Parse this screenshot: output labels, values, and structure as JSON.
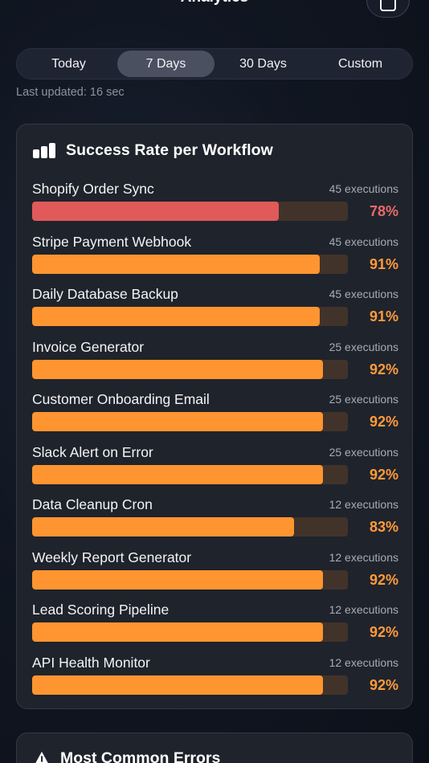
{
  "header": {
    "title": "Analytics",
    "action_icon": "share-icon"
  },
  "range_tabs": [
    {
      "label": "Today",
      "active": false
    },
    {
      "label": "7 Days",
      "active": true
    },
    {
      "label": "30 Days",
      "active": false
    },
    {
      "label": "Custom",
      "active": false
    }
  ],
  "last_updated": "Last updated: 16 sec",
  "success_card": {
    "title": "Success Rate per Workflow",
    "icon": "bar-chart-icon",
    "workflows": [
      {
        "name": "Shopify Order Sync",
        "executions": "45 executions",
        "rate": 0.78,
        "rate_label": "78%",
        "status": "critical"
      },
      {
        "name": "Stripe Payment Webhook",
        "executions": "45 executions",
        "rate": 0.91,
        "rate_label": "91%",
        "status": "warning"
      },
      {
        "name": "Daily Database Backup",
        "executions": "45 executions",
        "rate": 0.91,
        "rate_label": "91%",
        "status": "warning"
      },
      {
        "name": "Invoice Generator",
        "executions": "25 executions",
        "rate": 0.92,
        "rate_label": "92%",
        "status": "warning"
      },
      {
        "name": "Customer Onboarding Email",
        "executions": "25 executions",
        "rate": 0.92,
        "rate_label": "92%",
        "status": "warning"
      },
      {
        "name": "Slack Alert on Error",
        "executions": "25 executions",
        "rate": 0.92,
        "rate_label": "92%",
        "status": "warning"
      },
      {
        "name": "Data Cleanup Cron",
        "executions": "12 executions",
        "rate": 0.83,
        "rate_label": "83%",
        "status": "warning"
      },
      {
        "name": "Weekly Report Generator",
        "executions": "12 executions",
        "rate": 0.92,
        "rate_label": "92%",
        "status": "warning"
      },
      {
        "name": "Lead Scoring Pipeline",
        "executions": "12 executions",
        "rate": 0.92,
        "rate_label": "92%",
        "status": "warning"
      },
      {
        "name": "API Health Monitor",
        "executions": "12 executions",
        "rate": 0.92,
        "rate_label": "92%",
        "status": "warning"
      }
    ]
  },
  "errors_card": {
    "title": "Most Common Errors",
    "icon": "warning-icon"
  },
  "colors": {
    "critical_bar": "#e05a5a",
    "critical_text": "#e86a6a",
    "warning_bar": "#ff9530",
    "warning_text": "#ff9a3a"
  }
}
